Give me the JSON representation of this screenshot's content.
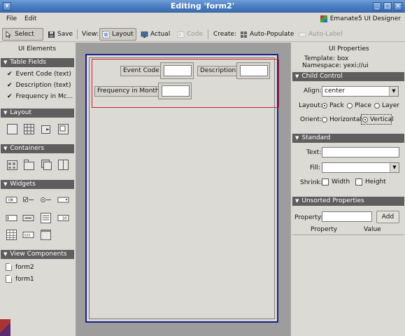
{
  "window": {
    "title": "Editing 'form2'"
  },
  "menu": {
    "file": "File",
    "edit": "Edit",
    "brand": "Emanate5 UI Designer"
  },
  "toolbar": {
    "select": "Select",
    "save": "Save",
    "view_label": "View:",
    "layout": "Layout",
    "actual": "Actual",
    "code": "Code",
    "create_label": "Create:",
    "auto_populate": "Auto-Populate",
    "auto_label": "Auto-Label"
  },
  "left": {
    "title": "UI Elements",
    "sections": {
      "table_fields": "Table Fields",
      "layout": "Layout",
      "containers": "Containers",
      "widgets": "Widgets",
      "view_components": "View Components"
    },
    "table_fields": [
      "Event Code (text)",
      "Description (text)",
      "Frequency in Mc..."
    ],
    "view_components": [
      "form2",
      "form1"
    ]
  },
  "form": {
    "labels": {
      "event_code": "Event Code",
      "description": "Description",
      "frequency": "Frequency in Months"
    }
  },
  "right": {
    "title": "UI Properties",
    "template": "Template: box",
    "namespace": "Namespace: yexi://ui",
    "sections": {
      "child_control": "Child Control",
      "standard": "Standard",
      "unsorted": "Unsorted Properties"
    },
    "align_label": "Align:",
    "align_value": "center",
    "layout_label": "Layout:",
    "layout_options": [
      "Pack",
      "Place",
      "Layer"
    ],
    "orient_label": "Orient:",
    "orient_options": [
      "Horizontal",
      "Vertical"
    ],
    "text_label": "Text:",
    "fill_label": "Fill:",
    "shrink_label": "Shrink:",
    "shrink_width": "Width",
    "shrink_height": "Height",
    "property_label": "Property:",
    "add_button": "Add",
    "col_property": "Property",
    "col_value": "Value"
  }
}
